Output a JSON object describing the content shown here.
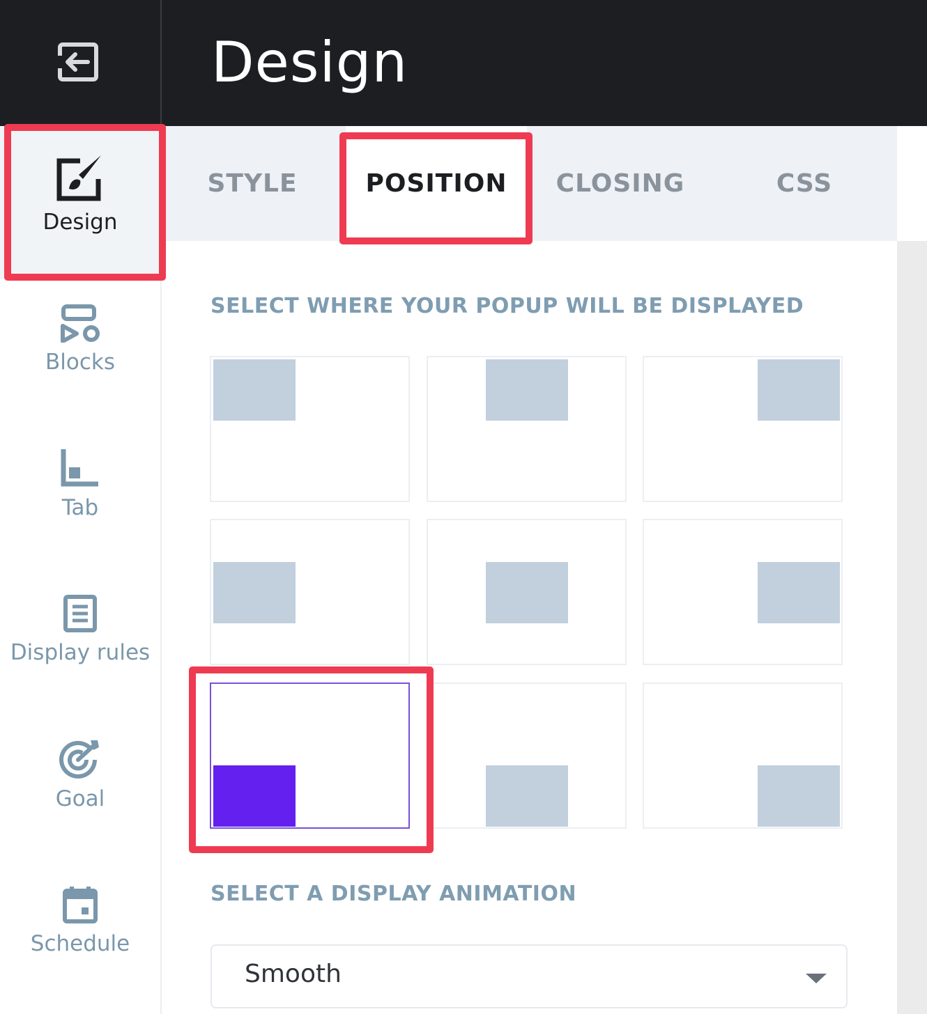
{
  "header": {
    "title": "Design"
  },
  "sidebar": {
    "items": [
      {
        "label": "Design",
        "icon": "brush-icon",
        "active": true
      },
      {
        "label": "Blocks",
        "icon": "blocks-icon"
      },
      {
        "label": "Tab",
        "icon": "tab-icon"
      },
      {
        "label": "Display rules",
        "icon": "list-icon"
      },
      {
        "label": "Goal",
        "icon": "target-icon"
      },
      {
        "label": "Schedule",
        "icon": "calendar-icon"
      }
    ]
  },
  "tabs": [
    {
      "label": "STYLE"
    },
    {
      "label": "POSITION",
      "active": true
    },
    {
      "label": "CLOSING"
    },
    {
      "label": "CSS"
    }
  ],
  "position": {
    "title": "SELECT WHERE YOUR POPUP WILL BE DISPLAYED",
    "options": [
      "top-left",
      "top-center",
      "top-right",
      "middle-left",
      "center",
      "middle-right",
      "bottom-left",
      "bottom-center",
      "bottom-right"
    ],
    "selected": "bottom-left"
  },
  "animation": {
    "title": "SELECT A DISPLAY ANIMATION",
    "value": "Smooth"
  },
  "colors": {
    "header_bg": "#1d1e22",
    "accent": "#6320ee",
    "highlight": "#ee3b52",
    "block": "#c2cfdd"
  }
}
